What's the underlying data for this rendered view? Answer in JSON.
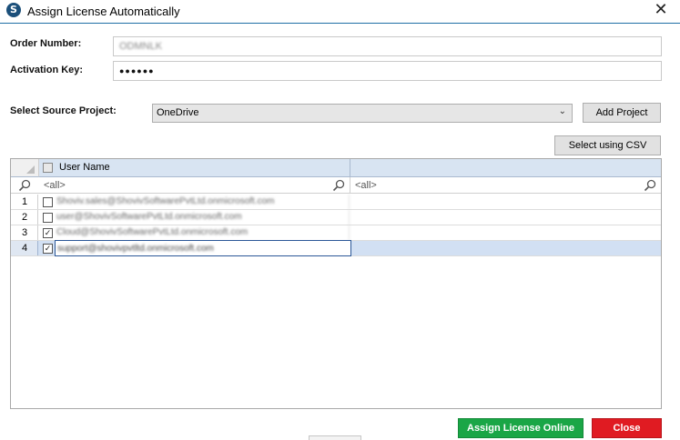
{
  "window": {
    "title": "Assign License Automatically",
    "icon_letter": "S",
    "close_glyph": "✕"
  },
  "form": {
    "order_number_label": "Order Number:",
    "order_number_value": "ODMNLK",
    "activation_key_label": "Activation Key:",
    "activation_key_value": "●●●●●●",
    "source_project_label": "Select Source Project:",
    "source_project_value": "OneDrive",
    "add_project_label": "Add Project",
    "select_csv_label": "Select using CSV"
  },
  "grid": {
    "header": {
      "user_name": "User Name"
    },
    "filter_placeholder": "<all>",
    "rows": [
      {
        "num": "1",
        "checked": false,
        "email": "Shoviv.sales@ShovivSoftwarePvtLtd.onmicrosoft.com"
      },
      {
        "num": "2",
        "checked": false,
        "email": "user@ShovivSoftwarePvtLtd.onmicrosoft.com"
      },
      {
        "num": "3",
        "checked": true,
        "email": "Cloud@ShovivSoftwarePvtLtd.onmicrosoft.com"
      },
      {
        "num": "4",
        "checked": true,
        "email": "support@shovivpvtltd.onmicrosoft.com"
      }
    ]
  },
  "footer": {
    "assign_label": "Assign License Online",
    "close_label": "Close"
  },
  "colors": {
    "accent": "#1aa646",
    "danger": "#e01b22",
    "header_bg": "#d8e4f2",
    "selected_row": "#d2e0f3"
  }
}
